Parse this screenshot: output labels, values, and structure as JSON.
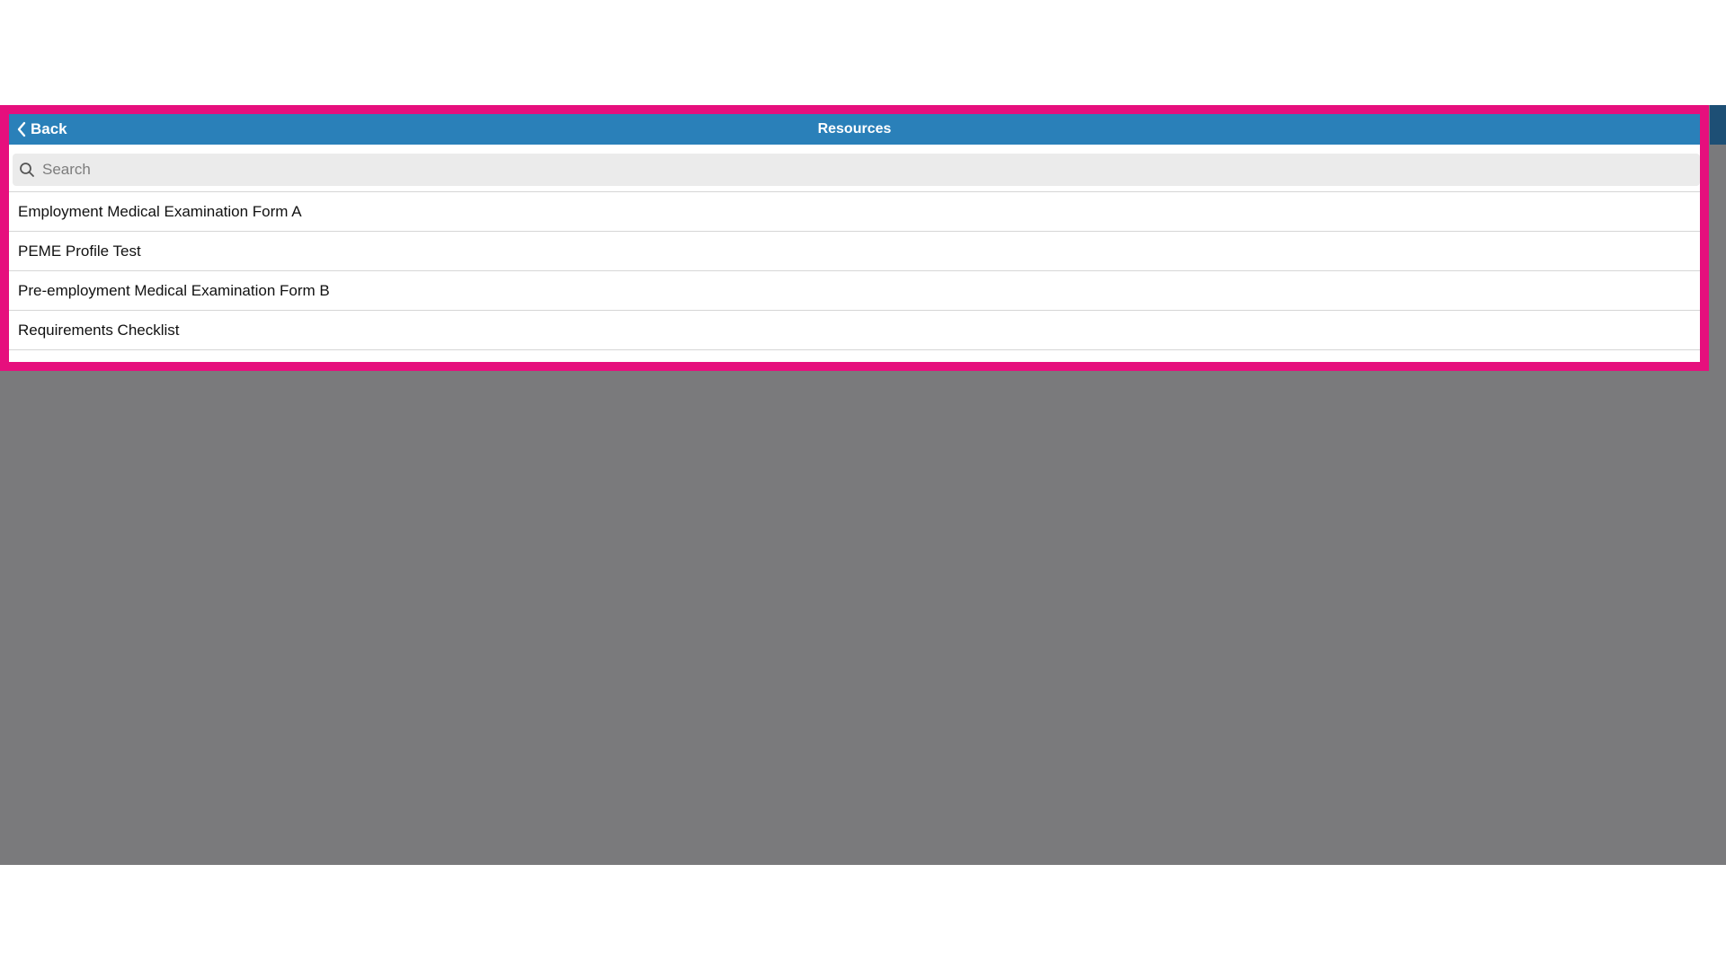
{
  "header": {
    "back_label": "Back",
    "title": "Resources"
  },
  "search": {
    "placeholder": "Search",
    "value": ""
  },
  "resources": [
    {
      "label": "Employment Medical Examination Form A"
    },
    {
      "label": "PEME Profile Test"
    },
    {
      "label": "Pre-employment Medical Examination Form B"
    },
    {
      "label": "Requirements Checklist"
    }
  ],
  "colors": {
    "header_bg": "#2a80b9",
    "highlight_border": "#e60f7d",
    "overlay": "#7a7a7c"
  },
  "icons": {
    "back": "chevron-left-icon",
    "search": "search-icon"
  }
}
